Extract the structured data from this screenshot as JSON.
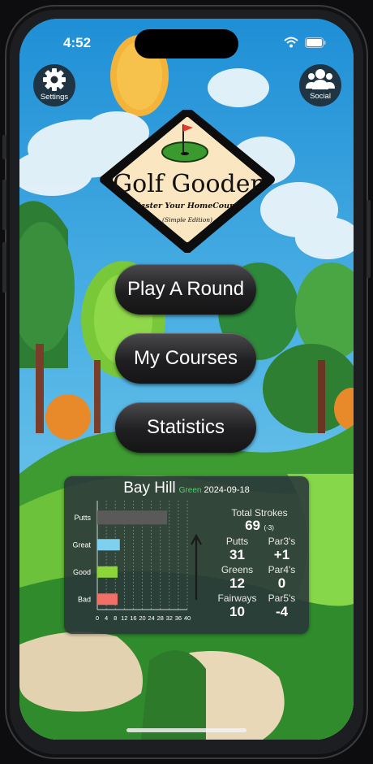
{
  "status_bar": {
    "time": "4:52"
  },
  "header": {
    "settings_label": "Settings",
    "social_label": "Social"
  },
  "logo": {
    "title": "Golf Gooder",
    "subtitle": "Master Your HomeCourse",
    "edition": "(Simple Edition)"
  },
  "menu": {
    "play_label": "Play A Round",
    "courses_label": "My Courses",
    "stats_label": "Statistics"
  },
  "round_card": {
    "course": "Bay Hill",
    "tee": "Green",
    "date": "2024-09-18",
    "total_strokes_label": "Total Strokes",
    "total_strokes": "69",
    "to_par": "(-3)",
    "putts_label": "Putts",
    "putts": "31",
    "par3_label": "Par3's",
    "par3": "+1",
    "greens_label": "Greens",
    "greens": "12",
    "par4_label": "Par4's",
    "par4": "0",
    "fairways_label": "Fairways",
    "fairways": "10",
    "par5_label": "Par5's",
    "par5": "-4"
  },
  "chart_data": {
    "type": "bar",
    "orientation": "horizontal",
    "categories": [
      "Putts",
      "Great",
      "Good",
      "Bad"
    ],
    "values": [
      31,
      10,
      9,
      9
    ],
    "colors": [
      "#5a5a5a",
      "#7fd0ef",
      "#8cd43a",
      "#f07068"
    ],
    "xlim": [
      0,
      40
    ],
    "xticks": [
      "0",
      "4",
      "8",
      "12",
      "16",
      "20",
      "24",
      "28",
      "32",
      "36",
      "40"
    ],
    "grid": true
  }
}
